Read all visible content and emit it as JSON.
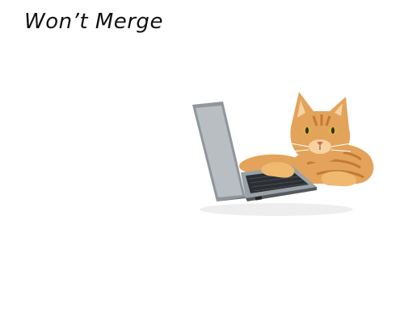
{
  "title": "Won’t Merge",
  "image": {
    "subject": "cat-with-laptop",
    "colors": {
      "cat_fur": "#e3a35a",
      "cat_fur_dark": "#c27a36",
      "cat_fur_light": "#f6d3a0",
      "laptop_body": "#8f969c",
      "laptop_screen": "#b9bec3",
      "keyboard": "#2b2e32"
    }
  }
}
